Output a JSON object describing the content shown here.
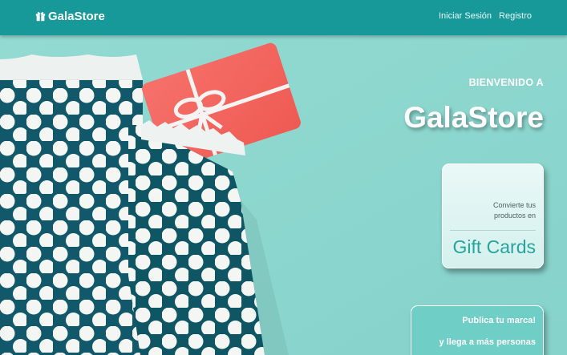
{
  "navbar": {
    "brand": "GalaStore",
    "brand_icon": "gift-icon",
    "links": [
      {
        "label": "Iniciar Sesión"
      },
      {
        "label": "Registro"
      }
    ]
  },
  "hero": {
    "welcome": "BIENVENIDO A",
    "title": "GalaStore",
    "image": "polka-dot gift bag with red gift card"
  },
  "gift_card_panel": {
    "subtitle": "Convierte tus productos en",
    "title": "Gift Cards"
  },
  "promo_panel": {
    "line1": "Publica tu marca!",
    "line2": "y llega a más personas"
  },
  "colors": {
    "navbar": "#17999a",
    "background": "#8fd8d0",
    "bag": "#0f5a66",
    "card": "#f2645d",
    "accent": "#27a39c"
  }
}
